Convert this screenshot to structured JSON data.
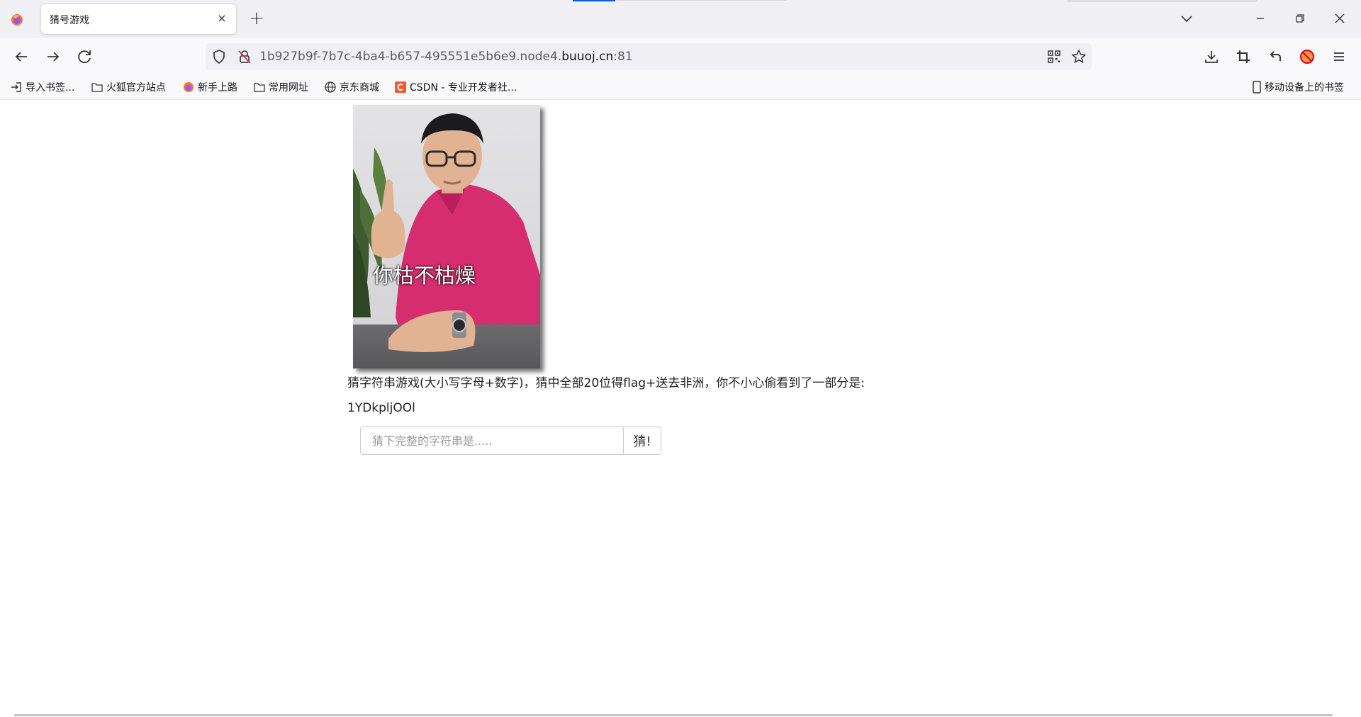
{
  "browser": {
    "tab": {
      "title": "猜号游戏",
      "close_glyph": "×"
    },
    "new_tab_glyph": "+",
    "url": {
      "prefix": "1b927b9f-7b7c-4ba4-b657-495551e5b6e9.node4.",
      "domain": "buuoj.cn",
      "port": ":81"
    },
    "bookmarks": [
      {
        "label": "导入书签...",
        "icon": "import-icon"
      },
      {
        "label": "火狐官方站点",
        "icon": "folder-icon"
      },
      {
        "label": "新手上路",
        "icon": "firefox-icon"
      },
      {
        "label": "常用网址",
        "icon": "folder-icon"
      },
      {
        "label": "京东商城",
        "icon": "globe-icon"
      },
      {
        "label": "CSDN - 专业开发者社...",
        "icon": "csdn-icon"
      }
    ],
    "mobile_bookmarks": "移动设备上的书签"
  },
  "page": {
    "meme_caption": "你枯不枯燥",
    "prompt": "猜字符串游戏(大小写字母+数字)，猜中全部20位得flag+送去非洲，你不小心偷看到了一部分是:",
    "hint": "1YDkpljOOl",
    "input_placeholder": "猜下完整的字符串是.....",
    "button_label": "猜!"
  },
  "colors": {
    "accent": "#0061e0",
    "tabbar_bg": "#f0f0f4",
    "toolbar_bg": "#f9f9fb",
    "shirt": "#d62d6e"
  }
}
